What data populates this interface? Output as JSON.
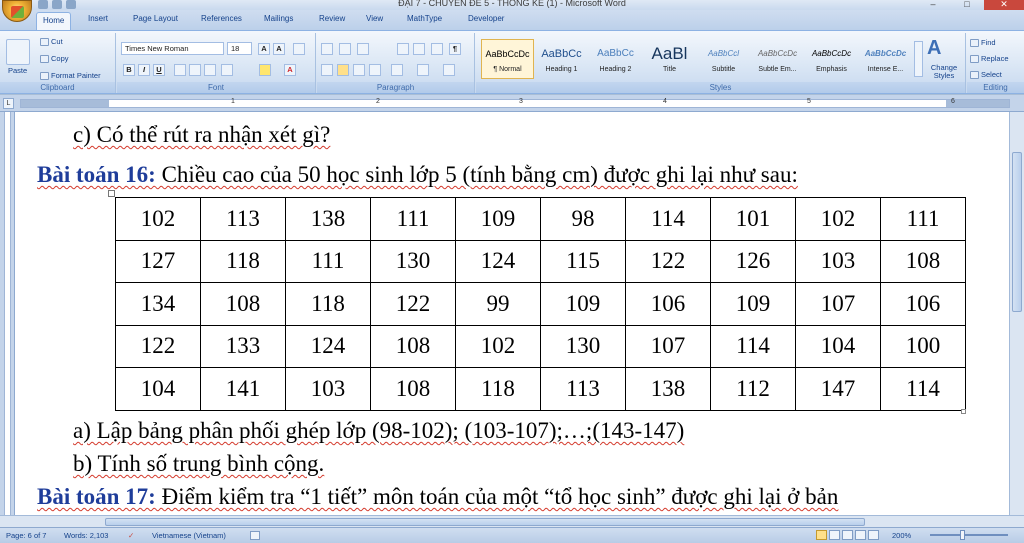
{
  "window": {
    "title": "ĐẠI 7 - CHUYÊN ĐỀ 5 - THỐNG KÊ (1) - Microsoft Word",
    "controls": [
      "–",
      "□",
      "✕"
    ]
  },
  "tabs": [
    "Home",
    "Insert",
    "Page Layout",
    "References",
    "Mailings",
    "Review",
    "View",
    "MathType",
    "Developer"
  ],
  "ribbon": {
    "clipboard": {
      "paste": "Paste",
      "cut": "Cut",
      "copy": "Copy",
      "format_painter": "Format Painter",
      "label": "Clipboard"
    },
    "font": {
      "name": "Times New Roman",
      "size": "18",
      "label": "Font"
    },
    "paragraph": {
      "label": "Paragraph"
    },
    "styles": {
      "label": "Styles",
      "items": [
        {
          "sample": "AaBbCcDc",
          "name": "¶ Normal"
        },
        {
          "sample": "AaBbCc",
          "name": "Heading 1"
        },
        {
          "sample": "AaBbCc",
          "name": "Heading 2"
        },
        {
          "sample": "AaBl",
          "name": "Title"
        },
        {
          "sample": "AaBbCcl",
          "name": "Subtitle"
        },
        {
          "sample": "AaBbCcDc",
          "name": "Subtle Em..."
        },
        {
          "sample": "AaBbCcDc",
          "name": "Emphasis"
        },
        {
          "sample": "AaBbCcDc",
          "name": "Intense E..."
        }
      ],
      "change_styles": "Change Styles"
    },
    "editing": {
      "find": "Find",
      "replace": "Replace",
      "select": "Select",
      "label": "Editing"
    }
  },
  "ruler": {
    "numbers": [
      "1",
      "2",
      "3",
      "4",
      "5",
      "6"
    ]
  },
  "document": {
    "line_c": "c)  Có thể rút ra nhận xét gì?",
    "problem16_label": "Bài toán 16:",
    "problem16_text": " Chiều cao của 50 học sinh lớp 5 (tính bằng cm) được ghi lại như sau:",
    "table": [
      [
        "102",
        "113",
        "138",
        "111",
        "109",
        "98",
        "114",
        "101",
        "102",
        "111"
      ],
      [
        "127",
        "118",
        "111",
        "130",
        "124",
        "115",
        "122",
        "126",
        "103",
        "108"
      ],
      [
        "134",
        "108",
        "118",
        "122",
        "99",
        "109",
        "106",
        "109",
        "107",
        "106"
      ],
      [
        "122",
        "133",
        "124",
        "108",
        "102",
        "130",
        "107",
        "114",
        "104",
        "100"
      ],
      [
        "104",
        "141",
        "103",
        "108",
        "118",
        "113",
        "138",
        "112",
        "147",
        "114"
      ]
    ],
    "line_a": "a)  Lập bảng phân phối ghép lớp (98-102); (103-107);…;(143-147)",
    "line_b": "b)  Tính số trung bình cộng.",
    "problem17_label": "Bài toán 17:",
    "problem17_text": " Điểm kiểm tra “1 tiết” môn toán của một “tổ học sinh” được ghi lại ở bản"
  },
  "status": {
    "page": "Page: 6 of 7",
    "words": "Words: 2,103",
    "language": "Vietnamese (Vietnam)",
    "zoom": "200%"
  }
}
